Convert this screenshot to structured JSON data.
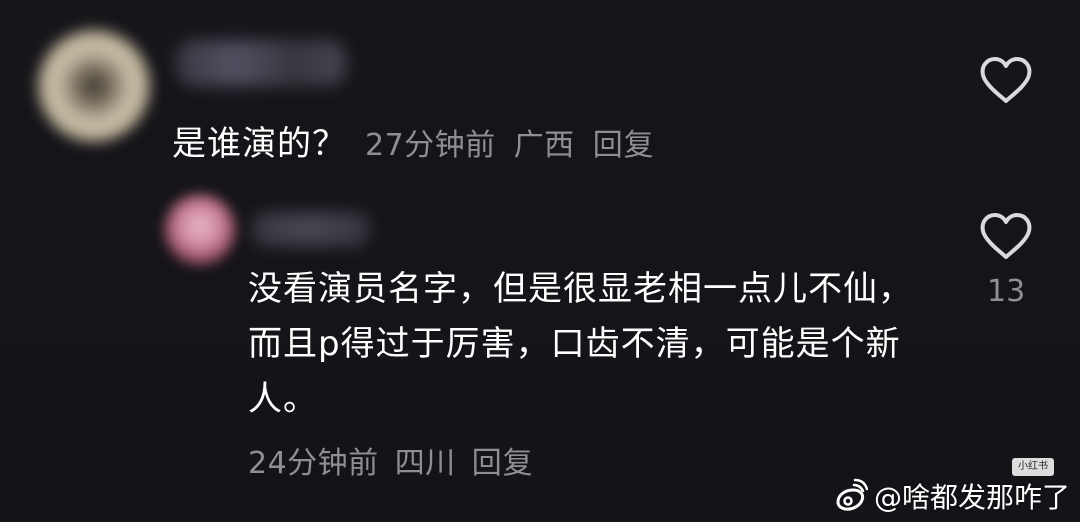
{
  "comment_thread": {
    "top_comment": {
      "text": "是谁演的？",
      "time": "27分钟前",
      "location": "广西",
      "reply_label": "回复"
    },
    "reply_comment": {
      "text": "没看演员名字，但是很显老相一点儿不仙，而且p得过于厉害，口齿不清，可能是个新人。",
      "time": "24分钟前",
      "location": "四川",
      "reply_label": "回复",
      "like_count": "13"
    }
  },
  "icons": {
    "like": "heart-outline-icon",
    "watermark": "weibo-icon"
  },
  "watermarks": {
    "small": "小红书",
    "main": "@啥都发那咋了"
  },
  "colors": {
    "background": "#151419",
    "primary_text": "#ffffff",
    "secondary_text": "#8f8d96",
    "heart_outline": "#d9d9de"
  }
}
